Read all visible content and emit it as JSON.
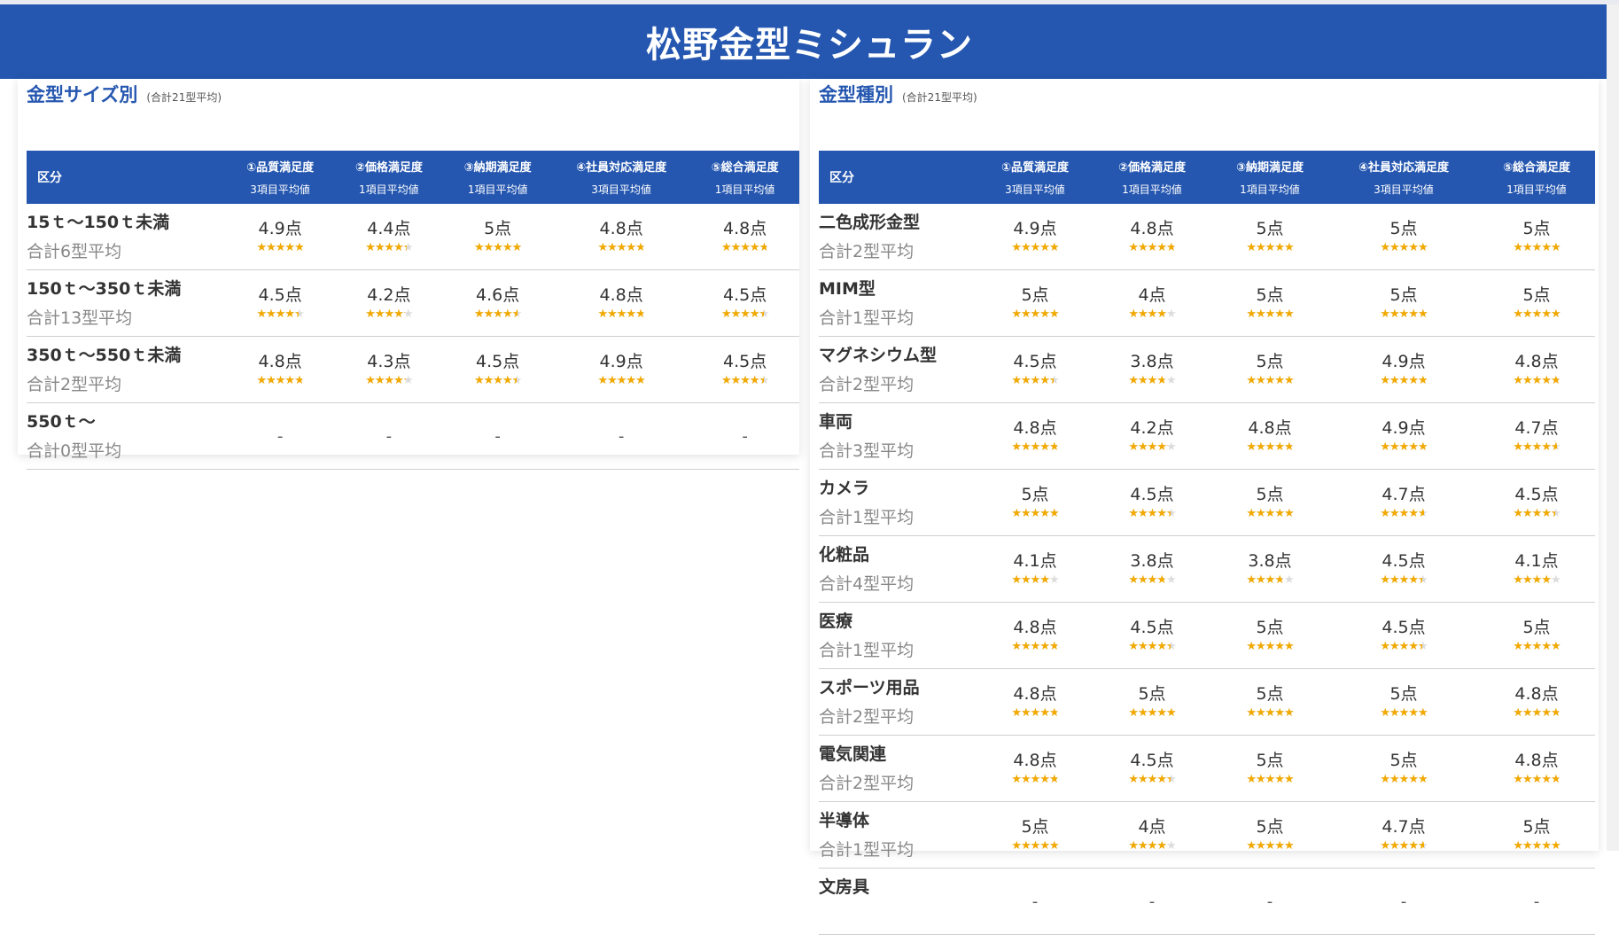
{
  "title": "松野金型ミシュラン",
  "columns": [
    {
      "label": "①品質満足度",
      "sub": "3項目平均値"
    },
    {
      "label": "②価格満足度",
      "sub": "1項目平均値"
    },
    {
      "label": "③納期満足度",
      "sub": "1項目平均値"
    },
    {
      "label": "④社員対応満足度",
      "sub": "3項目平均値"
    },
    {
      "label": "⑤総合満足度",
      "sub": "1項目平均値"
    }
  ],
  "kubun_label": "区分",
  "left": {
    "title": "金型サイズ別",
    "subtitle": "(合計21型平均)",
    "rows": [
      {
        "name": "15ｔ～150ｔ未満",
        "count": "合計6型平均",
        "scores": [
          4.9,
          4.4,
          5,
          4.8,
          4.8
        ]
      },
      {
        "name": "150ｔ～350ｔ未満",
        "count": "合計13型平均",
        "scores": [
          4.5,
          4.2,
          4.6,
          4.8,
          4.5
        ]
      },
      {
        "name": "350ｔ～550ｔ未満",
        "count": "合計2型平均",
        "scores": [
          4.8,
          4.3,
          4.5,
          4.9,
          4.5
        ]
      },
      {
        "name": "550ｔ～",
        "count": "合計0型平均",
        "scores": [
          null,
          null,
          null,
          null,
          null
        ]
      }
    ]
  },
  "right": {
    "title": "金型種別",
    "subtitle": "(合計21型平均)",
    "rows": [
      {
        "name": "二色成形金型",
        "count": "合計2型平均",
        "scores": [
          4.9,
          4.8,
          5,
          5,
          5
        ]
      },
      {
        "name": "MIM型",
        "count": "合計1型平均",
        "scores": [
          5,
          4,
          5,
          5,
          5
        ]
      },
      {
        "name": "マグネシウム型",
        "count": "合計2型平均",
        "scores": [
          4.5,
          3.8,
          5,
          4.9,
          4.8
        ]
      },
      {
        "name": "車両",
        "count": "合計3型平均",
        "scores": [
          4.8,
          4.2,
          4.8,
          4.9,
          4.7
        ]
      },
      {
        "name": "カメラ",
        "count": "合計1型平均",
        "scores": [
          5,
          4.5,
          5,
          4.7,
          4.5
        ]
      },
      {
        "name": "化粧品",
        "count": "合計4型平均",
        "scores": [
          4.1,
          3.8,
          3.8,
          4.5,
          4.1
        ]
      },
      {
        "name": "医療",
        "count": "合計1型平均",
        "scores": [
          4.8,
          4.5,
          5,
          4.5,
          5
        ]
      },
      {
        "name": "スポーツ用品",
        "count": "合計2型平均",
        "scores": [
          4.8,
          5,
          5,
          5,
          4.8
        ]
      },
      {
        "name": "電気関連",
        "count": "合計2型平均",
        "scores": [
          4.8,
          4.5,
          5,
          5,
          4.8
        ]
      },
      {
        "name": "半導体",
        "count": "合計1型平均",
        "scores": [
          5,
          4,
          5,
          4.7,
          5
        ]
      },
      {
        "name": "文房具",
        "count": "",
        "scores": [
          null,
          null,
          null,
          null,
          null
        ]
      }
    ]
  },
  "score_suffix": "点",
  "empty_mark": "-",
  "colors": {
    "header": "#2557b0",
    "star": "#f2a900",
    "star_empty": "#dcdcdc"
  }
}
